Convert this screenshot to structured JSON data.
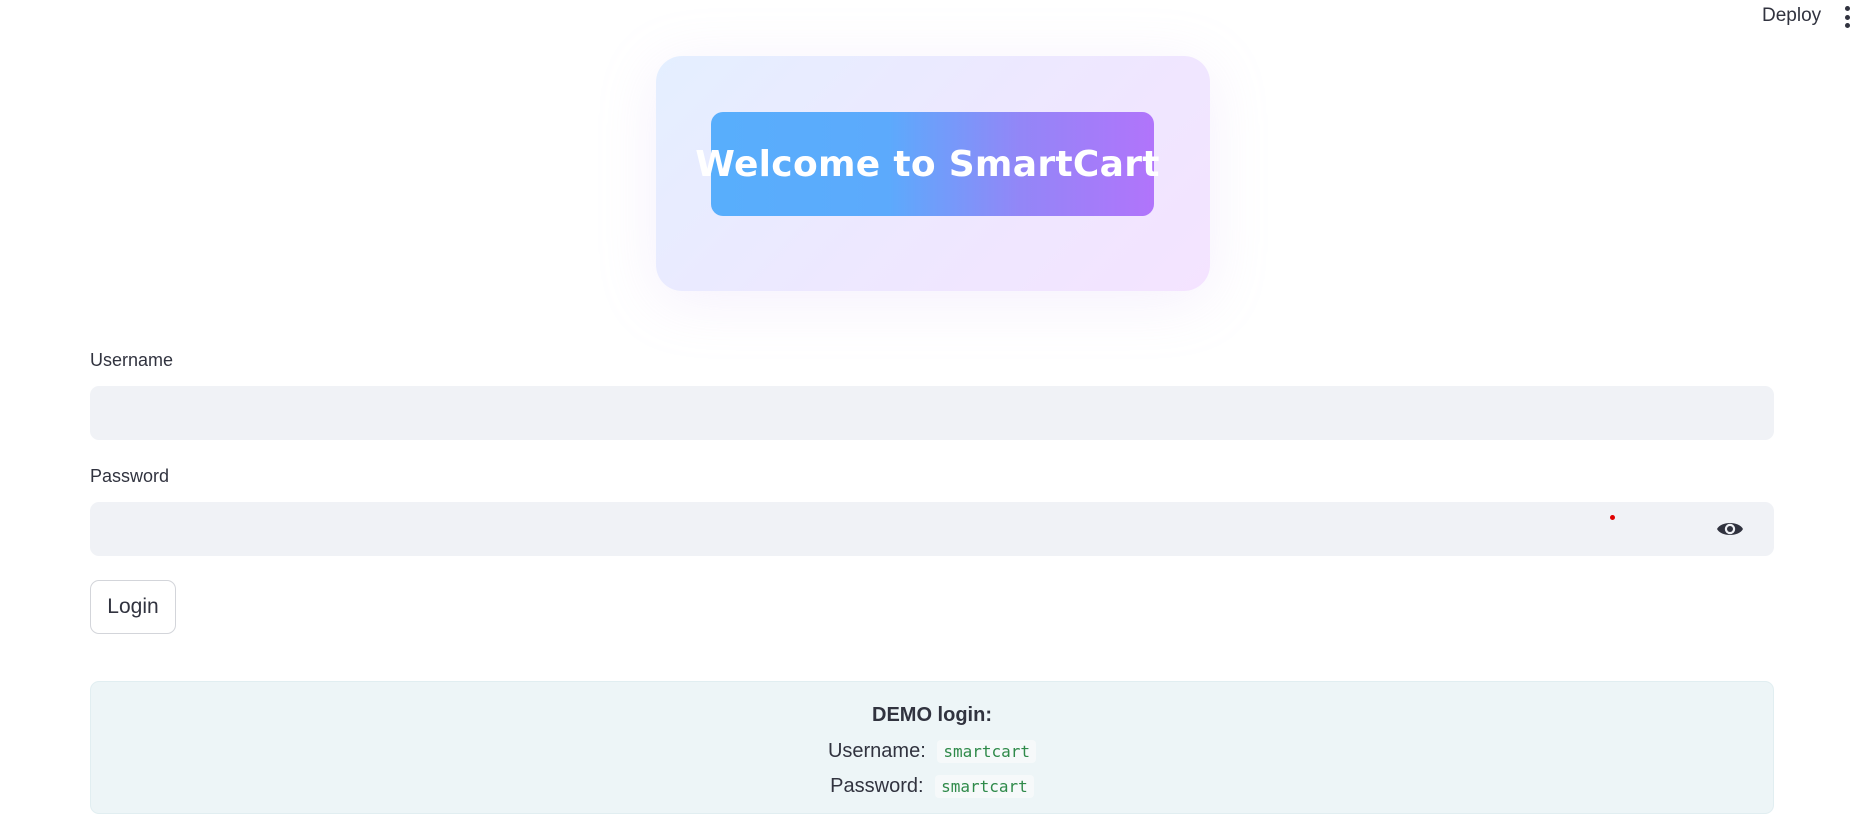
{
  "toolbar": {
    "deploy_label": "Deploy"
  },
  "hero": {
    "title": "Welcome to SmartCart",
    "icon": "shopping-cart-icon"
  },
  "form": {
    "username_label": "Username",
    "username_value": "",
    "password_label": "Password",
    "password_value": "",
    "login_label": "Login"
  },
  "demo": {
    "title": "DEMO login:",
    "username_label": "Username:",
    "username_value": "smartcart",
    "password_label": "Password:",
    "password_value": "smartcart"
  },
  "colors": {
    "banner_start": "#58aefc",
    "banner_end": "#b174fb",
    "code_text": "#2f8a4a"
  }
}
